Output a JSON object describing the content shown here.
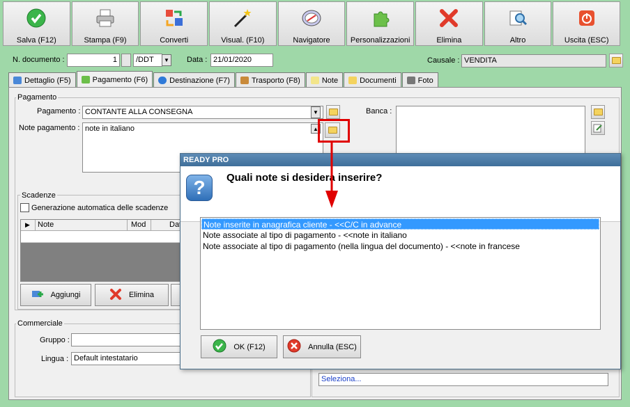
{
  "toolbar": [
    {
      "label": "Salva (F12)",
      "icon": "check-circle-icon"
    },
    {
      "label": "Stampa (F9)",
      "icon": "printer-icon"
    },
    {
      "label": "Converti",
      "icon": "convert-icon"
    },
    {
      "label": "Visual. (F10)",
      "icon": "magic-wand-icon"
    },
    {
      "label": "Navigatore",
      "icon": "compass-icon"
    },
    {
      "label": "Personalizzazioni",
      "icon": "puzzle-icon"
    },
    {
      "label": "Elimina",
      "icon": "red-x-icon"
    },
    {
      "label": "Altro",
      "icon": "search-doc-icon"
    },
    {
      "label": "Uscita (ESC)",
      "icon": "power-icon"
    }
  ],
  "header": {
    "doc_label": "N. documento :",
    "doc_number": "1",
    "doc_type": "/DDT",
    "date_label": "Data :",
    "date": "21/01/2020",
    "causale_label": "Causale :",
    "causale": "VENDITA"
  },
  "tabs": [
    {
      "label": "Dettaglio (F5)",
      "active": false
    },
    {
      "label": "Pagamento (F6)",
      "active": true
    },
    {
      "label": "Destinazione (F7)",
      "active": false
    },
    {
      "label": "Trasporto (F8)",
      "active": false
    },
    {
      "label": "Note",
      "active": false
    },
    {
      "label": "Documenti",
      "active": false
    },
    {
      "label": "Foto",
      "active": false
    }
  ],
  "pagamento": {
    "group_title": "Pagamento",
    "pagamento_label": "Pagamento :",
    "pagamento_value": "CONTANTE ALLA CONSEGNA",
    "note_label": "Note pagamento :",
    "note_value": "note in italiano",
    "banca_label": "Banca :"
  },
  "scadenze": {
    "group_title": "Scadenze",
    "auto_label": "Generazione automatica delle scadenze",
    "columns": [
      "Note",
      "Mod",
      "Dat"
    ],
    "add_button": "Aggiungi",
    "delete_button": "Elimina"
  },
  "commerciale": {
    "group_title": "Commerciale",
    "gruppo_label": "Gruppo :",
    "lingua_label": "Lingua :",
    "lingua_value": "Default intestatario"
  },
  "seleziona": "Seleziona...",
  "dialog": {
    "title": "READY PRO",
    "question": "Quali note si desidera inserire?",
    "options": [
      "Note inserite in anagrafica cliente - <<C/C in advance",
      "Note associate al tipo di pagamento - <<note in italiano",
      "Note associate al tipo di pagamento (nella lingua del documento) - <<note in francese"
    ],
    "ok_label": "OK (F12)",
    "cancel_label": "Annulla (ESC)"
  },
  "colors": {
    "background": "#9fd8a8",
    "highlight": "#3399ff",
    "annotation": "#e00000"
  }
}
